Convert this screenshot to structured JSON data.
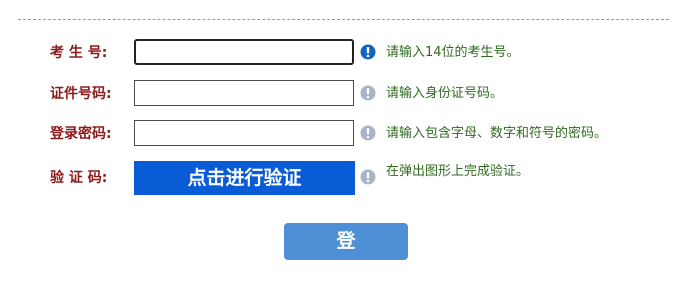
{
  "form": {
    "exam_no": {
      "label": "考 生 号:",
      "value": "",
      "hint": "请输入14位的考生号。"
    },
    "id_no": {
      "label": "证件号码:",
      "value": "",
      "hint": "请输入身份证号码。"
    },
    "password": {
      "label": "登录密码:",
      "value": "",
      "hint": "请输入包含字母、数字和符号的密码。"
    },
    "captcha": {
      "label": "验 证 码:",
      "button_label": "点击进行验证",
      "hint": "在弹出图形上完成验证。"
    },
    "login_label": "登 录"
  },
  "colors": {
    "label": "#8b1a1a",
    "hint": "#2f6b1f",
    "captcha_button": "#0a5bd6",
    "login_button": "#4f8fd6",
    "active_info_icon": "#1565c0",
    "inactive_info_icon": "#a9b4c8"
  },
  "icons": {
    "active": "info-icon",
    "inactive": "info-icon-muted"
  }
}
